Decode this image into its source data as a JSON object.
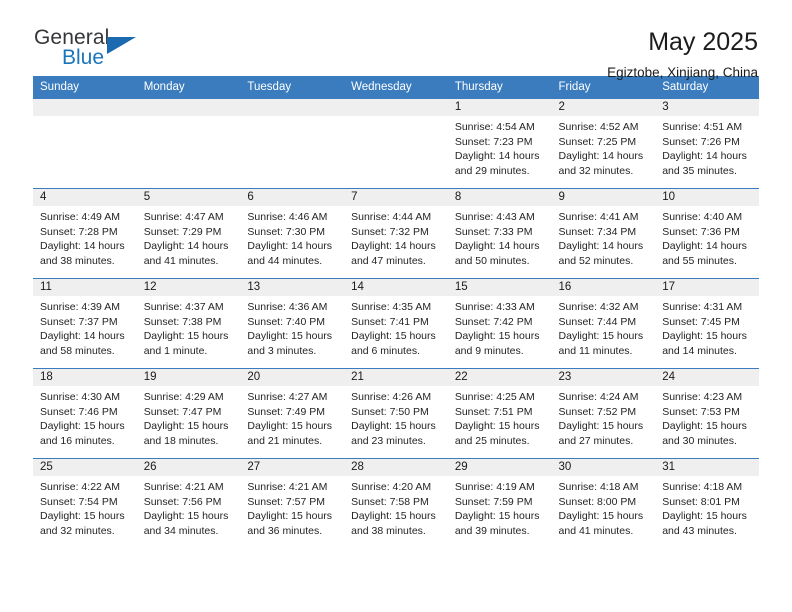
{
  "brand": {
    "name_part1": "General",
    "name_part2": "Blue",
    "accent_color": "#1b75bb",
    "triangle_color": "#1b6ab0"
  },
  "header": {
    "title": "May 2025",
    "subtitle": "Egiztobe, Xinjiang, China"
  },
  "calendar": {
    "header_bg": "#3a7cbe",
    "band_bg": "#efefef",
    "weekdays": [
      "Sunday",
      "Monday",
      "Tuesday",
      "Wednesday",
      "Thursday",
      "Friday",
      "Saturday"
    ],
    "weeks": [
      [
        {
          "day": "",
          "lines": []
        },
        {
          "day": "",
          "lines": []
        },
        {
          "day": "",
          "lines": []
        },
        {
          "day": "",
          "lines": []
        },
        {
          "day": "1",
          "lines": [
            "Sunrise: 4:54 AM",
            "Sunset: 7:23 PM",
            "Daylight: 14 hours",
            "and 29 minutes."
          ]
        },
        {
          "day": "2",
          "lines": [
            "Sunrise: 4:52 AM",
            "Sunset: 7:25 PM",
            "Daylight: 14 hours",
            "and 32 minutes."
          ]
        },
        {
          "day": "3",
          "lines": [
            "Sunrise: 4:51 AM",
            "Sunset: 7:26 PM",
            "Daylight: 14 hours",
            "and 35 minutes."
          ]
        }
      ],
      [
        {
          "day": "4",
          "lines": [
            "Sunrise: 4:49 AM",
            "Sunset: 7:28 PM",
            "Daylight: 14 hours",
            "and 38 minutes."
          ]
        },
        {
          "day": "5",
          "lines": [
            "Sunrise: 4:47 AM",
            "Sunset: 7:29 PM",
            "Daylight: 14 hours",
            "and 41 minutes."
          ]
        },
        {
          "day": "6",
          "lines": [
            "Sunrise: 4:46 AM",
            "Sunset: 7:30 PM",
            "Daylight: 14 hours",
            "and 44 minutes."
          ]
        },
        {
          "day": "7",
          "lines": [
            "Sunrise: 4:44 AM",
            "Sunset: 7:32 PM",
            "Daylight: 14 hours",
            "and 47 minutes."
          ]
        },
        {
          "day": "8",
          "lines": [
            "Sunrise: 4:43 AM",
            "Sunset: 7:33 PM",
            "Daylight: 14 hours",
            "and 50 minutes."
          ]
        },
        {
          "day": "9",
          "lines": [
            "Sunrise: 4:41 AM",
            "Sunset: 7:34 PM",
            "Daylight: 14 hours",
            "and 52 minutes."
          ]
        },
        {
          "day": "10",
          "lines": [
            "Sunrise: 4:40 AM",
            "Sunset: 7:36 PM",
            "Daylight: 14 hours",
            "and 55 minutes."
          ]
        }
      ],
      [
        {
          "day": "11",
          "lines": [
            "Sunrise: 4:39 AM",
            "Sunset: 7:37 PM",
            "Daylight: 14 hours",
            "and 58 minutes."
          ]
        },
        {
          "day": "12",
          "lines": [
            "Sunrise: 4:37 AM",
            "Sunset: 7:38 PM",
            "Daylight: 15 hours",
            "and 1 minute."
          ]
        },
        {
          "day": "13",
          "lines": [
            "Sunrise: 4:36 AM",
            "Sunset: 7:40 PM",
            "Daylight: 15 hours",
            "and 3 minutes."
          ]
        },
        {
          "day": "14",
          "lines": [
            "Sunrise: 4:35 AM",
            "Sunset: 7:41 PM",
            "Daylight: 15 hours",
            "and 6 minutes."
          ]
        },
        {
          "day": "15",
          "lines": [
            "Sunrise: 4:33 AM",
            "Sunset: 7:42 PM",
            "Daylight: 15 hours",
            "and 9 minutes."
          ]
        },
        {
          "day": "16",
          "lines": [
            "Sunrise: 4:32 AM",
            "Sunset: 7:44 PM",
            "Daylight: 15 hours",
            "and 11 minutes."
          ]
        },
        {
          "day": "17",
          "lines": [
            "Sunrise: 4:31 AM",
            "Sunset: 7:45 PM",
            "Daylight: 15 hours",
            "and 14 minutes."
          ]
        }
      ],
      [
        {
          "day": "18",
          "lines": [
            "Sunrise: 4:30 AM",
            "Sunset: 7:46 PM",
            "Daylight: 15 hours",
            "and 16 minutes."
          ]
        },
        {
          "day": "19",
          "lines": [
            "Sunrise: 4:29 AM",
            "Sunset: 7:47 PM",
            "Daylight: 15 hours",
            "and 18 minutes."
          ]
        },
        {
          "day": "20",
          "lines": [
            "Sunrise: 4:27 AM",
            "Sunset: 7:49 PM",
            "Daylight: 15 hours",
            "and 21 minutes."
          ]
        },
        {
          "day": "21",
          "lines": [
            "Sunrise: 4:26 AM",
            "Sunset: 7:50 PM",
            "Daylight: 15 hours",
            "and 23 minutes."
          ]
        },
        {
          "day": "22",
          "lines": [
            "Sunrise: 4:25 AM",
            "Sunset: 7:51 PM",
            "Daylight: 15 hours",
            "and 25 minutes."
          ]
        },
        {
          "day": "23",
          "lines": [
            "Sunrise: 4:24 AM",
            "Sunset: 7:52 PM",
            "Daylight: 15 hours",
            "and 27 minutes."
          ]
        },
        {
          "day": "24",
          "lines": [
            "Sunrise: 4:23 AM",
            "Sunset: 7:53 PM",
            "Daylight: 15 hours",
            "and 30 minutes."
          ]
        }
      ],
      [
        {
          "day": "25",
          "lines": [
            "Sunrise: 4:22 AM",
            "Sunset: 7:54 PM",
            "Daylight: 15 hours",
            "and 32 minutes."
          ]
        },
        {
          "day": "26",
          "lines": [
            "Sunrise: 4:21 AM",
            "Sunset: 7:56 PM",
            "Daylight: 15 hours",
            "and 34 minutes."
          ]
        },
        {
          "day": "27",
          "lines": [
            "Sunrise: 4:21 AM",
            "Sunset: 7:57 PM",
            "Daylight: 15 hours",
            "and 36 minutes."
          ]
        },
        {
          "day": "28",
          "lines": [
            "Sunrise: 4:20 AM",
            "Sunset: 7:58 PM",
            "Daylight: 15 hours",
            "and 38 minutes."
          ]
        },
        {
          "day": "29",
          "lines": [
            "Sunrise: 4:19 AM",
            "Sunset: 7:59 PM",
            "Daylight: 15 hours",
            "and 39 minutes."
          ]
        },
        {
          "day": "30",
          "lines": [
            "Sunrise: 4:18 AM",
            "Sunset: 8:00 PM",
            "Daylight: 15 hours",
            "and 41 minutes."
          ]
        },
        {
          "day": "31",
          "lines": [
            "Sunrise: 4:18 AM",
            "Sunset: 8:01 PM",
            "Daylight: 15 hours",
            "and 43 minutes."
          ]
        }
      ]
    ]
  }
}
